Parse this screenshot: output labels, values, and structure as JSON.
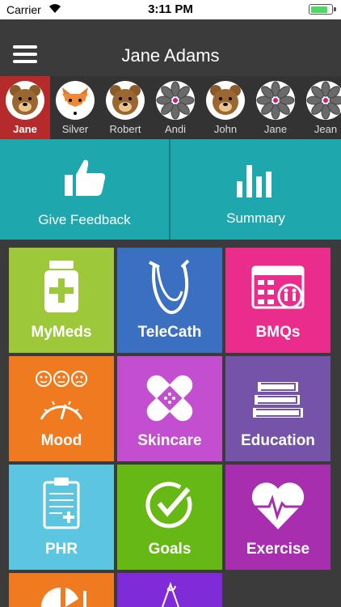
{
  "status": {
    "carrier": "Carrier",
    "time": "3:11 PM",
    "battery_level": 0.85
  },
  "nav": {
    "title": "Jane Adams"
  },
  "profiles": [
    {
      "name": "Jane",
      "avatar": "bear-icon",
      "selected": true
    },
    {
      "name": "Silver",
      "avatar": "fox-icon",
      "selected": false
    },
    {
      "name": "Robert",
      "avatar": "bear-icon",
      "selected": false
    },
    {
      "name": "Andi",
      "avatar": "flower-icon",
      "selected": false
    },
    {
      "name": "John",
      "avatar": "bear-icon",
      "selected": false
    },
    {
      "name": "Jane",
      "avatar": "flower-icon",
      "selected": false
    },
    {
      "name": "Jean",
      "avatar": "flower-icon",
      "selected": false
    }
  ],
  "top_tiles": [
    {
      "label": "Give Feedback",
      "icon": "thumbs-up-icon"
    },
    {
      "label": "Summary",
      "icon": "bar-chart-icon"
    }
  ],
  "tiles": [
    {
      "label": "MyMeds",
      "icon": "pill-bottle-icon",
      "color": "#9cc83a"
    },
    {
      "label": "TeleCath",
      "icon": "catheter-icon",
      "color": "#3b6fbf"
    },
    {
      "label": "BMQs",
      "icon": "calendar-icon",
      "color": "#ea2c8c"
    },
    {
      "label": "Mood",
      "icon": "mood-gauge-icon",
      "color": "#f07a1f"
    },
    {
      "label": "Skincare",
      "icon": "bandage-icon",
      "color": "#c34ecf"
    },
    {
      "label": "Education",
      "icon": "books-icon",
      "color": "#7453a8"
    },
    {
      "label": "PHR",
      "icon": "clipboard-icon",
      "color": "#5cc6e0"
    },
    {
      "label": "Goals",
      "icon": "check-circle-icon",
      "color": "#66b814"
    },
    {
      "label": "Exercise",
      "icon": "heart-pulse-icon",
      "color": "#a72eae"
    },
    {
      "label": "",
      "icon": "nutrition-icon",
      "color": "#f07a1f"
    },
    {
      "label": "",
      "icon": "sketch-icon",
      "color": "#7f2bd8"
    }
  ],
  "colors": {
    "teal": "#1fa7ae",
    "selected": "#b52a2a",
    "background": "#3b3b3b"
  }
}
